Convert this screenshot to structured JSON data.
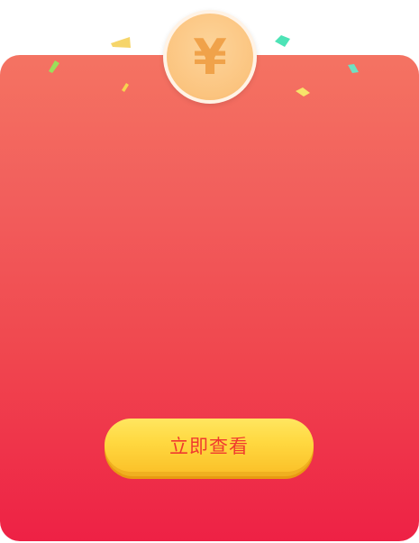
{
  "coin": {
    "symbol": "¥",
    "icon": "yuan-coin-icon"
  },
  "confetti": [
    {
      "name": "confetti-yellow-left",
      "color": "#f6d56a"
    },
    {
      "name": "confetti-green-left",
      "color": "#9be05a"
    },
    {
      "name": "confetti-yellow-small",
      "color": "#f7d34f"
    },
    {
      "name": "confetti-teal-top",
      "color": "#4de3b6"
    },
    {
      "name": "confetti-yellow-right",
      "color": "#f7e36a"
    },
    {
      "name": "confetti-teal-right",
      "color": "#6fe0c2"
    }
  ],
  "card": {
    "gradient_top": "#f47362",
    "gradient_bottom": "#ee2145"
  },
  "cta": {
    "label": "立即查看",
    "color": "#ffd840",
    "text_color": "#f03a2e"
  }
}
